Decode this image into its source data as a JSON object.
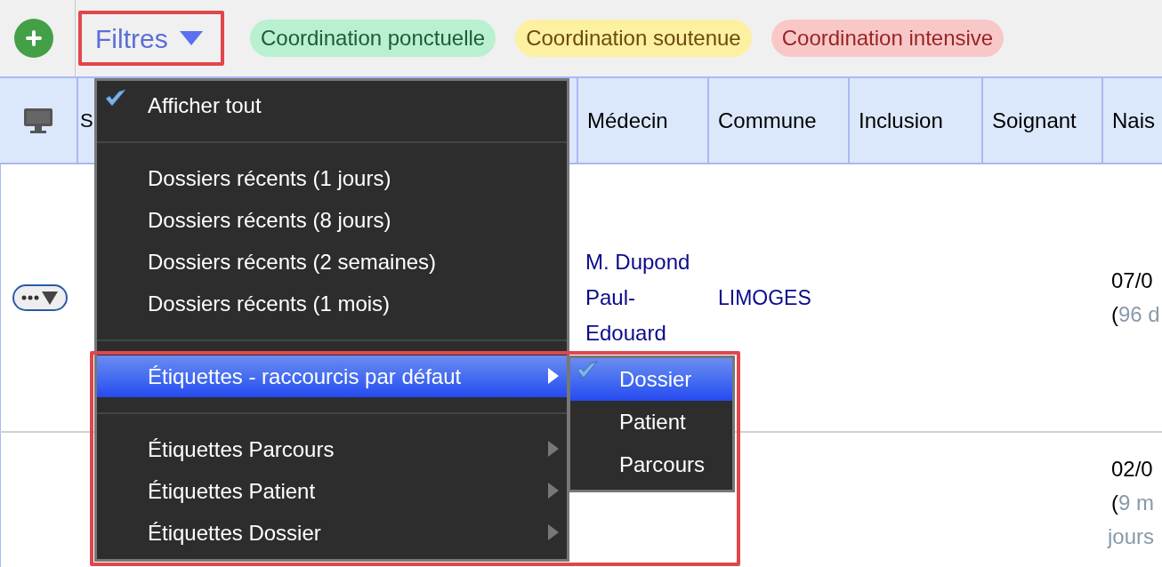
{
  "toolbar": {
    "filter_button": {
      "label": "Filtres"
    },
    "chips": [
      {
        "label": "Coordination ponctuelle",
        "color": "#b8f0d0"
      },
      {
        "label": "Coordination soutenue",
        "color": "#fdf0a0"
      },
      {
        "label": "Coordination intensive",
        "color": "#f8c8c8"
      }
    ]
  },
  "table": {
    "columns": [
      {
        "kind": "icon"
      },
      {
        "kind": "text",
        "label": "S"
      },
      {
        "kind": "text",
        "label": "Médecin"
      },
      {
        "kind": "text",
        "label": "Commune"
      },
      {
        "kind": "text",
        "label": "Inclusion"
      },
      {
        "kind": "text",
        "label": "Soignant"
      },
      {
        "kind": "text",
        "label": "Nais"
      }
    ],
    "rows": [
      {
        "has_actions": true,
        "medecin": "M. Dupond Paul-Edouard",
        "commune": "LIMOGES",
        "birth_date": "07/0",
        "age_open": "(",
        "age_lines": [
          "96 d"
        ]
      },
      {
        "has_actions": false,
        "birth_date": "02/0",
        "age_open": "(",
        "age_lines": [
          "9 m",
          "jours"
        ]
      }
    ]
  },
  "menu": {
    "items": [
      {
        "kind": "check",
        "label": "Afficher tout",
        "checked": true,
        "highlighted": false
      },
      {
        "kind": "divider"
      },
      {
        "kind": "item",
        "label": "Dossiers récents (1 jours)",
        "checked": false,
        "highlighted": false
      },
      {
        "kind": "item",
        "label": "Dossiers récents (8 jours)",
        "checked": false,
        "highlighted": false
      },
      {
        "kind": "item",
        "label": "Dossiers récents (2 semaines)",
        "checked": false,
        "highlighted": false
      },
      {
        "kind": "item",
        "label": "Dossiers récents (1 mois)",
        "checked": false,
        "highlighted": false
      },
      {
        "kind": "divider"
      },
      {
        "kind": "submenu",
        "label": "Étiquettes - raccourcis par défaut",
        "checked": false,
        "highlighted": true
      },
      {
        "kind": "divider"
      },
      {
        "kind": "submenu",
        "label": "Étiquettes Parcours",
        "checked": false,
        "highlighted": false
      },
      {
        "kind": "submenu",
        "label": "Étiquettes Patient",
        "checked": false,
        "highlighted": false
      },
      {
        "kind": "submenu",
        "label": "Étiquettes Dossier",
        "checked": false,
        "highlighted": false
      }
    ],
    "submenu": [
      {
        "label": "Dossier",
        "checked": true,
        "selected": true
      },
      {
        "label": "Patient",
        "checked": false,
        "selected": false
      },
      {
        "label": "Parcours",
        "checked": false,
        "selected": false
      }
    ]
  }
}
